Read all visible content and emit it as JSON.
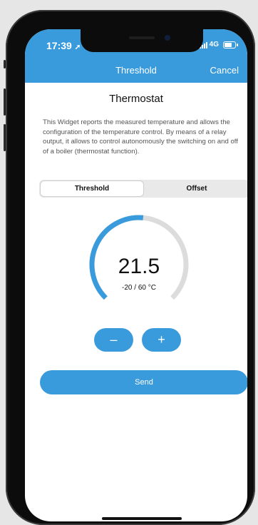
{
  "status_bar": {
    "time": "17:39",
    "location_icon": "location-arrow-icon",
    "network": "4G",
    "battery_level": 0.8
  },
  "nav": {
    "title": "Threshold",
    "cancel_label": "Cancel"
  },
  "widget": {
    "title": "Thermostat",
    "description": "This Widget reports the measured temperature and allows the configuration of the temperature control. By means of a relay output, it allows to control autonomously the switching on and off of a boiler (thermostat function)."
  },
  "tabs": [
    {
      "label": "Threshold",
      "active": true
    },
    {
      "label": "Offset",
      "active": false
    }
  ],
  "gauge": {
    "value": "21.5",
    "range": "-20 / 60 °C",
    "min": -20,
    "max": 60,
    "current": 21.5
  },
  "buttons": {
    "minus": "–",
    "plus": "+",
    "send": "Send"
  },
  "colors": {
    "accent": "#3a9bdc",
    "track": "#dcdcdc"
  }
}
